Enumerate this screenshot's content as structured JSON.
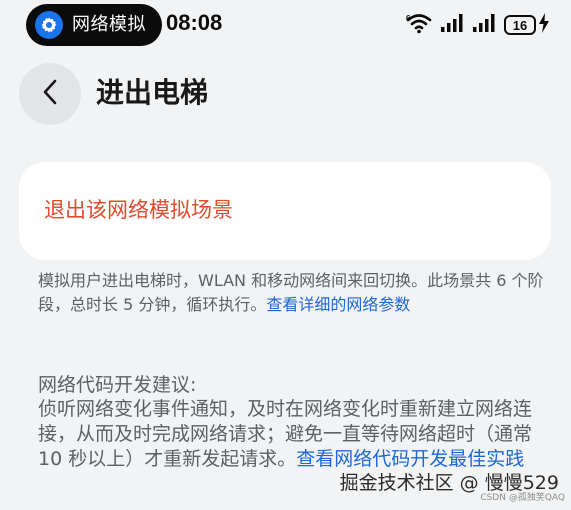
{
  "status_bar": {
    "pill_label": "网络模拟",
    "time": "08:08",
    "battery": "16",
    "icons": [
      "settings-icon",
      "wifi-6-icon",
      "cell-signal-icon",
      "cell-signal-icon",
      "battery-icon",
      "charging-bolt-icon"
    ]
  },
  "header": {
    "title": "进出电梯",
    "back_icon": "chevron-left-icon"
  },
  "card": {
    "action_label": "退出该网络模拟场景"
  },
  "description": {
    "text": "模拟用户进出电梯时，WLAN 和移动网络间来回切换。此场景共 6 个阶段，总时长 5 分钟，循环执行。",
    "link": "查看详细的网络参数"
  },
  "advice": {
    "title": "网络代码开发建议:",
    "body": "侦听网络变化事件通知，及时在网络变化时重新建立网络连接，从而及时完成网络请求；避免一直等待网络超时（通常 10 秒以上）才重新发起请求。",
    "link": "查看网络代码开发最佳实践"
  },
  "watermark": {
    "main": "掘金技术社区 @ 慢慢529",
    "sub": "CSDN @孤独笑QAQ"
  },
  "colors": {
    "background": "#f1f3f5",
    "accent_red": "#e04a2f",
    "link_blue": "#2068d8",
    "secondary_text": "#5e6063"
  }
}
